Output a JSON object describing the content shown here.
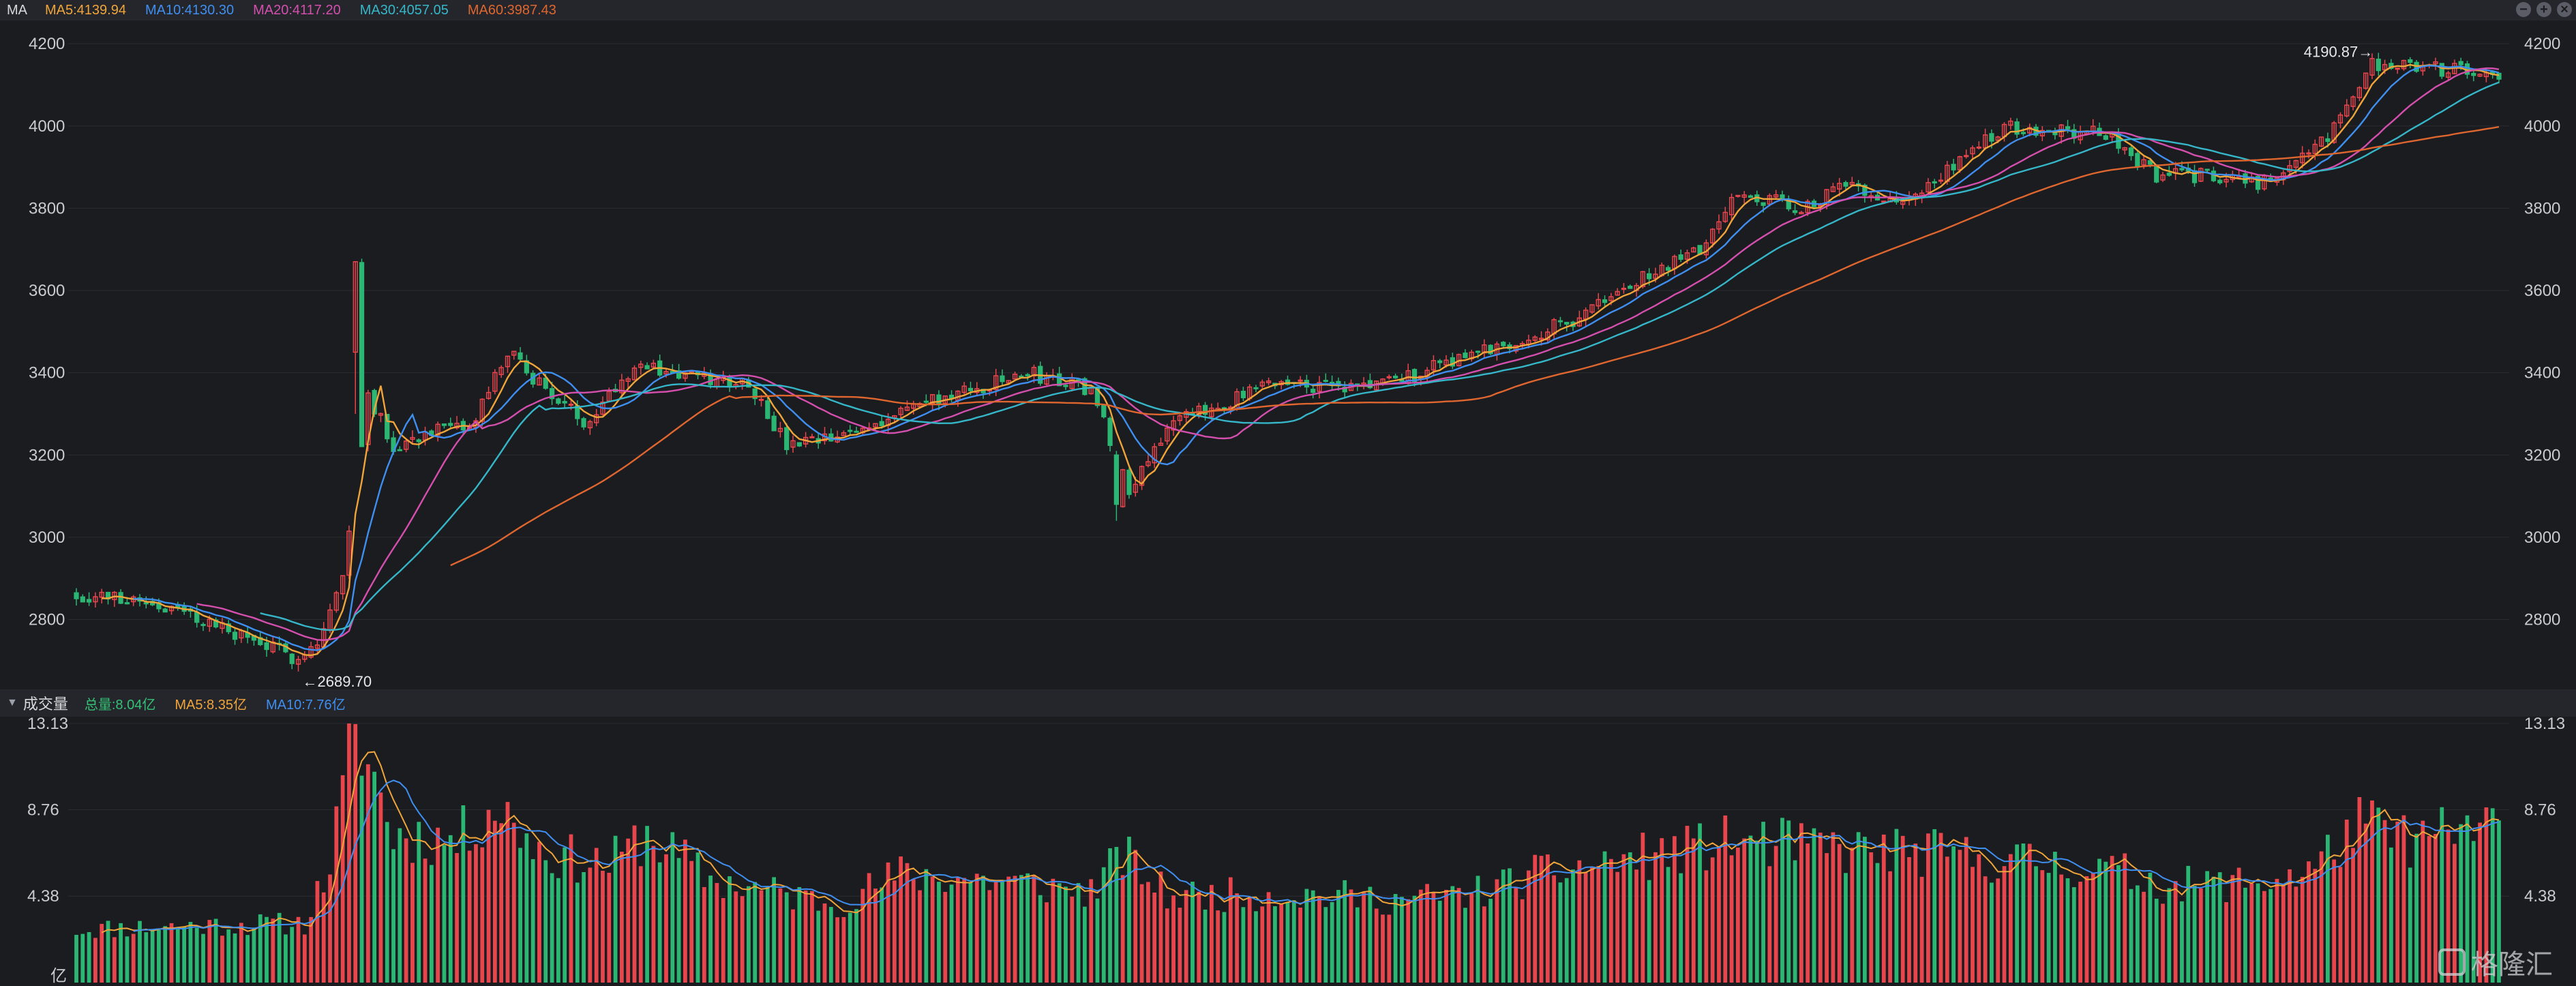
{
  "header": {
    "label": "MA",
    "items": [
      {
        "text": "MA5:4139.94",
        "color": "#f0a53a"
      },
      {
        "text": "MA10:4130.30",
        "color": "#3f8ff0"
      },
      {
        "text": "MA20:4117.20",
        "color": "#d54fae"
      },
      {
        "text": "MA30:4057.05",
        "color": "#35b7c9"
      },
      {
        "text": "MA60:3987.43",
        "color": "#e0662f"
      }
    ]
  },
  "window_controls": {
    "minimize": "−",
    "maximize": "+",
    "close": "×"
  },
  "volume_header": {
    "title": "成交量",
    "items": [
      {
        "text": "总量:8.04亿",
        "color": "#34c176"
      },
      {
        "text": "MA5:8.35亿",
        "color": "#f0a53a"
      },
      {
        "text": "MA10:7.76亿",
        "color": "#3f8ff0"
      }
    ]
  },
  "watermark": {
    "text": "格隆汇"
  },
  "colors": {
    "up": "#e8464d",
    "down": "#2bb673",
    "grid": "#2a2c32",
    "axis_text": "#c9cbd1"
  },
  "chart_data": [
    {
      "type": "candlestick",
      "title": "",
      "y_ticks": [
        4200,
        4000,
        3800,
        3600,
        3400,
        3200,
        3000,
        2800
      ],
      "ylim": [
        2640,
        4240
      ],
      "annotations": {
        "high_label": "4190.87",
        "low_label": "2689.70"
      },
      "trend_anchors": [
        [
          0,
          2860
        ],
        [
          10,
          2850
        ],
        [
          18,
          2810
        ],
        [
          26,
          2760
        ],
        [
          34,
          2710
        ],
        [
          38,
          2740
        ],
        [
          42,
          2900
        ],
        [
          46,
          3350
        ],
        [
          50,
          3220
        ],
        [
          56,
          3260
        ],
        [
          62,
          3260
        ],
        [
          68,
          3450
        ],
        [
          74,
          3360
        ],
        [
          80,
          3280
        ],
        [
          88,
          3420
        ],
        [
          94,
          3400
        ],
        [
          100,
          3380
        ],
        [
          106,
          3380
        ],
        [
          112,
          3220
        ],
        [
          120,
          3240
        ],
        [
          126,
          3280
        ],
        [
          132,
          3320
        ],
        [
          140,
          3350
        ],
        [
          150,
          3400
        ],
        [
          160,
          3360
        ],
        [
          166,
          3120
        ],
        [
          172,
          3270
        ],
        [
          180,
          3320
        ],
        [
          190,
          3380
        ],
        [
          200,
          3360
        ],
        [
          210,
          3390
        ],
        [
          216,
          3430
        ],
        [
          226,
          3470
        ],
        [
          236,
          3530
        ],
        [
          246,
          3620
        ],
        [
          256,
          3700
        ],
        [
          262,
          3840
        ],
        [
          272,
          3800
        ],
        [
          280,
          3860
        ],
        [
          288,
          3810
        ],
        [
          296,
          3900
        ],
        [
          304,
          4000
        ],
        [
          312,
          3990
        ],
        [
          320,
          3980
        ],
        [
          328,
          3880
        ],
        [
          336,
          3880
        ],
        [
          346,
          3860
        ],
        [
          356,
          3990
        ],
        [
          362,
          4150
        ],
        [
          372,
          4140
        ],
        [
          382,
          4130
        ]
      ],
      "spike": {
        "index": 44,
        "open": 3450,
        "close": 3670,
        "high": 3670,
        "low": 3300
      },
      "dip": {
        "index": 164,
        "open": 3200,
        "close": 3080,
        "high": 3210,
        "low": 3040
      },
      "moving_averages": [
        {
          "name": "MA5",
          "period": 5,
          "color": "#f0a53a"
        },
        {
          "name": "MA10",
          "period": 10,
          "color": "#3f8ff0"
        },
        {
          "name": "MA20",
          "period": 20,
          "color": "#d54fae"
        },
        {
          "name": "MA30",
          "period": 30,
          "color": "#35b7c9"
        },
        {
          "name": "MA60",
          "period": 60,
          "color": "#e0662f"
        }
      ]
    },
    {
      "type": "bar",
      "title": "",
      "y_ticks": [
        "13.13",
        "8.76",
        "4.38"
      ],
      "unit_label": "亿",
      "ylim": [
        0,
        13.13
      ],
      "volume_anchors": [
        [
          0,
          2.7
        ],
        [
          20,
          2.9
        ],
        [
          36,
          3.0
        ],
        [
          40,
          6.0
        ],
        [
          44,
          13.1
        ],
        [
          50,
          7.5
        ],
        [
          60,
          7.2
        ],
        [
          66,
          9.0
        ],
        [
          74,
          6.5
        ],
        [
          84,
          6.0
        ],
        [
          90,
          7.5
        ],
        [
          100,
          5.2
        ],
        [
          110,
          4.6
        ],
        [
          120,
          4.0
        ],
        [
          130,
          5.5
        ],
        [
          140,
          5.3
        ],
        [
          150,
          5.0
        ],
        [
          160,
          4.6
        ],
        [
          165,
          6.5
        ],
        [
          172,
          4.4
        ],
        [
          190,
          4.5
        ],
        [
          210,
          4.2
        ],
        [
          220,
          4.5
        ],
        [
          230,
          5.4
        ],
        [
          240,
          6.0
        ],
        [
          250,
          6.5
        ],
        [
          262,
          7.2
        ],
        [
          275,
          6.8
        ],
        [
          290,
          6.6
        ],
        [
          300,
          6.3
        ],
        [
          312,
          6.0
        ],
        [
          322,
          5.6
        ],
        [
          330,
          4.9
        ],
        [
          345,
          5.1
        ],
        [
          352,
          5.6
        ],
        [
          360,
          8.0
        ],
        [
          368,
          7.2
        ],
        [
          382,
          8.0
        ]
      ]
    }
  ]
}
